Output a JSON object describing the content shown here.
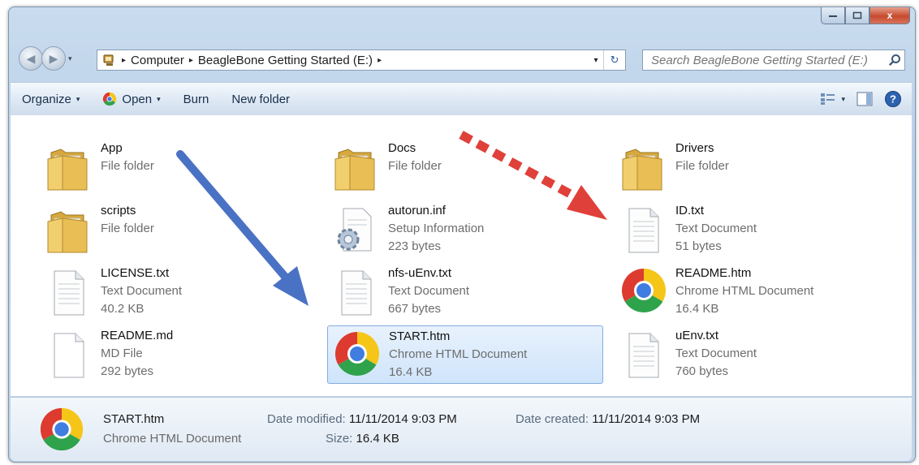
{
  "window": {
    "close_glyph": "x"
  },
  "nav": {
    "back_glyph": "◀",
    "forward_glyph": "▶",
    "recent_glyph": "▾"
  },
  "address": {
    "crumbs": [
      "Computer",
      "BeagleBone Getting Started (E:)"
    ],
    "sep": "▸",
    "dropdown_glyph": "▾",
    "refresh_glyph": "↻"
  },
  "search": {
    "placeholder": "Search BeagleBone Getting Started (E:)"
  },
  "toolbar": {
    "organize": "Organize",
    "open": "Open",
    "burn": "Burn",
    "new_folder": "New folder",
    "caret": "▾"
  },
  "files": [
    {
      "name": "App",
      "type": "File folder",
      "size": "",
      "icon": "folder-icon"
    },
    {
      "name": "scripts",
      "type": "File folder",
      "size": "",
      "icon": "folder-icon"
    },
    {
      "name": "LICENSE.txt",
      "type": "Text Document",
      "size": "40.2 KB",
      "icon": "text-document-icon"
    },
    {
      "name": "README.md",
      "type": "MD File",
      "size": "292 bytes",
      "icon": "blank-file-icon"
    },
    {
      "name": "Docs",
      "type": "File folder",
      "size": "",
      "icon": "folder-icon"
    },
    {
      "name": "autorun.inf",
      "type": "Setup Information",
      "size": "223 bytes",
      "icon": "setup-information-icon"
    },
    {
      "name": "nfs-uEnv.txt",
      "type": "Text Document",
      "size": "667 bytes",
      "icon": "text-document-icon"
    },
    {
      "name": "START.htm",
      "type": "Chrome HTML Document",
      "size": "16.4 KB",
      "icon": "chrome-icon",
      "selected": true
    },
    {
      "name": "Drivers",
      "type": "File folder",
      "size": "",
      "icon": "folder-icon"
    },
    {
      "name": "ID.txt",
      "type": "Text Document",
      "size": "51 bytes",
      "icon": "text-document-icon"
    },
    {
      "name": "README.htm",
      "type": "Chrome HTML Document",
      "size": "16.4 KB",
      "icon": "chrome-icon"
    },
    {
      "name": "uEnv.txt",
      "type": "Text Document",
      "size": "760 bytes",
      "icon": "text-document-icon"
    }
  ],
  "details": {
    "name": "START.htm",
    "type": "Chrome HTML Document",
    "modified_label": "Date modified:",
    "modified_value": "11/11/2014 9:03 PM",
    "created_label": "Date created:",
    "created_value": "11/11/2014 9:03 PM",
    "size_label": "Size:",
    "size_value": "16.4 KB"
  },
  "colors": {
    "blue_arrow": "#4a72c4",
    "red_arrow": "#e0403a",
    "selection": "#cfe4fb",
    "toolbar_text": "#1a2f4c"
  }
}
